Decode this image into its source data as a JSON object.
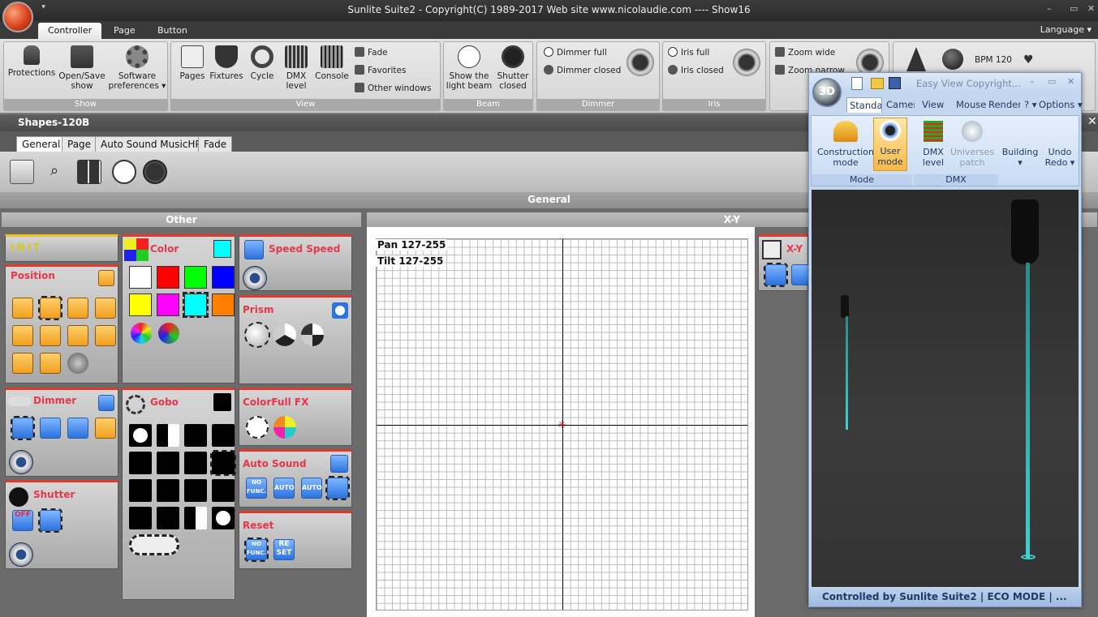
{
  "app": {
    "title": "Sunlite Suite2 - Copyright(C) 1989-2017   Web site www.nicolaudie.com ---- Show16",
    "quick_access": "⯆",
    "language": "Language ▾",
    "window_controls": [
      "–",
      "▭",
      "✕"
    ]
  },
  "ribbon_tabs": [
    "Controller",
    "Page",
    "Button"
  ],
  "ribbon": {
    "show": {
      "label": "Show",
      "protections": "Protections",
      "open_save_1": "Open/Save",
      "open_save_2": "show",
      "software_1": "Software",
      "software_2": "preferences ▾"
    },
    "view": {
      "label": "View",
      "pages": "Pages",
      "fixtures": "Fixtures",
      "cycle": "Cycle",
      "dmx_1": "DMX",
      "dmx_2": "level",
      "console": "Console",
      "fade": "Fade",
      "favorites": "Favorites",
      "other_windows": "Other windows"
    },
    "beam": {
      "label": "Beam",
      "show_1": "Show the",
      "show_2": "light beam",
      "shutter_1": "Shutter",
      "shutter_2": "closed"
    },
    "dimmer": {
      "label": "Dimmer",
      "full": "Dimmer full",
      "closed": "Dimmer closed"
    },
    "iris": {
      "label": "Iris",
      "full": "Iris full",
      "closed": "Iris closed"
    },
    "zoom": {
      "wide": "Zoom wide",
      "narrow": "Zoom narrow"
    },
    "bpm": "BPM 120"
  },
  "panel": {
    "title": "Shapes-120B",
    "tabs": [
      "General",
      "Page",
      "Auto Sound MusicHP",
      "Fade"
    ],
    "section": "General",
    "other_header": "Other",
    "xy_header": "X-Y"
  },
  "boxes": {
    "init": "INIT",
    "position": "Position",
    "dimmer": "Dimmer",
    "shutter": "Shutter",
    "color": "Color",
    "gobo": "Gobo",
    "speed": "Speed Speed",
    "prism": "Prism",
    "colorfull": "ColorFull FX",
    "auto_sound": "Auto Sound",
    "reset": "Reset",
    "xy": "X-Y",
    "shutter_off": "OFF",
    "no_func": "NO FUNC.",
    "auto": "AUTO",
    "reset_btn": "RE SET"
  },
  "colors": [
    "#ffffff",
    "#ff0000",
    "#00ff00",
    "#0000ff",
    "#ffff00",
    "#ff00ff",
    "#00ffff",
    "#ff8000"
  ],
  "xy": {
    "pan": "Pan 127-255",
    "tilt": "Tilt 127-255"
  },
  "viewer3d": {
    "ball": "3D",
    "title": "Easy View  Copyright...",
    "tabs": [
      "Standa",
      "Camer",
      "View",
      "Mouse",
      "Render",
      "? ▾",
      "Options ▾"
    ],
    "construction_1": "Construction",
    "construction_2": "mode",
    "user_1": "User",
    "user_2": "mode",
    "dmx_1": "DMX",
    "dmx_2": "level",
    "universes_1": "Universes",
    "universes_2": "patch",
    "building_1": "Building",
    "building_2": "▾",
    "undo_1": "Undo",
    "undo_2": "Redo ▾",
    "group_mode": "Mode",
    "group_dmx": "DMX",
    "status": "Controlled by Sunlite Suite2  |  ECO MODE  |  ..."
  }
}
